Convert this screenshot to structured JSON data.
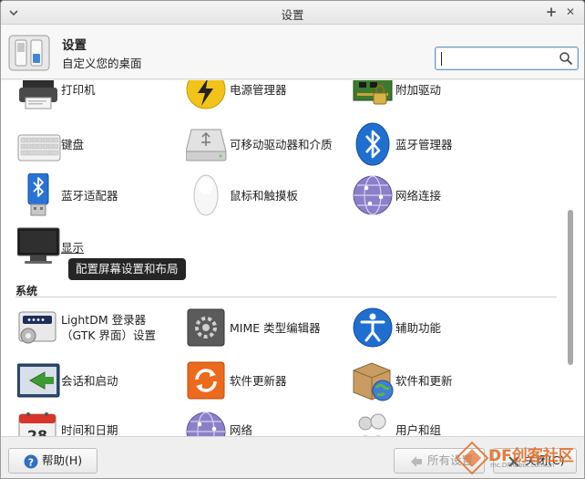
{
  "window": {
    "title": "设置",
    "buttons": {
      "maximize": "+",
      "close": "✕"
    }
  },
  "header": {
    "title": "设置",
    "subtitle": "自定义您的桌面",
    "search": {
      "value": "",
      "placeholder": ""
    }
  },
  "content": {
    "rows": [
      {
        "items": [
          {
            "label": "打印机",
            "icon": "printer-icon"
          },
          {
            "label": "电源管理器",
            "icon": "power-manager-icon"
          },
          {
            "label": "附加驱动",
            "icon": "additional-drivers-icon"
          }
        ]
      },
      {
        "items": [
          {
            "label": "键盘",
            "icon": "keyboard-icon"
          },
          {
            "label": "可移动驱动器和介质",
            "icon": "removable-drives-icon"
          },
          {
            "label": "蓝牙管理器",
            "icon": "bluetooth-manager-icon"
          }
        ]
      },
      {
        "items": [
          {
            "label": "蓝牙适配器",
            "icon": "bluetooth-adapter-icon"
          },
          {
            "label": "鼠标和触摸板",
            "icon": "mouse-icon"
          },
          {
            "label": "网络连接",
            "icon": "network-connections-icon"
          }
        ]
      },
      {
        "items": [
          {
            "label": "显示",
            "icon": "display-icon"
          }
        ]
      }
    ],
    "tooltip": "配置屏幕设置和布局",
    "section": {
      "title": "系统",
      "rows": [
        {
          "items": [
            {
              "label": "LightDM 登录器（GTK 界面）设置",
              "icon": "lightdm-icon"
            },
            {
              "label": "MIME 类型编辑器",
              "icon": "mime-editor-icon"
            },
            {
              "label": "辅助功能",
              "icon": "accessibility-icon"
            }
          ]
        },
        {
          "items": [
            {
              "label": "会话和启动",
              "icon": "session-startup-icon"
            },
            {
              "label": "软件更新器",
              "icon": "software-updater-icon"
            },
            {
              "label": "软件和更新",
              "icon": "software-updates-icon"
            }
          ]
        },
        {
          "items": [
            {
              "label": "时间和日期",
              "icon": "time-date-icon"
            },
            {
              "label": "网络",
              "icon": "network-icon"
            },
            {
              "label": "用户和组",
              "icon": "users-groups-icon"
            }
          ]
        }
      ]
    }
  },
  "footer": {
    "help_label": "帮助(H)",
    "all_settings_label": "所有设置",
    "close_label": "关闭(C)"
  },
  "watermark": {
    "text": "DF创客社区",
    "url": "mc.DFRobot.com.cn"
  },
  "colors": {
    "accent": "#6d9ac9",
    "bluetooth": "#1f6fd1",
    "tooltip_bg": "#141414",
    "watermark": "#e16e28"
  }
}
